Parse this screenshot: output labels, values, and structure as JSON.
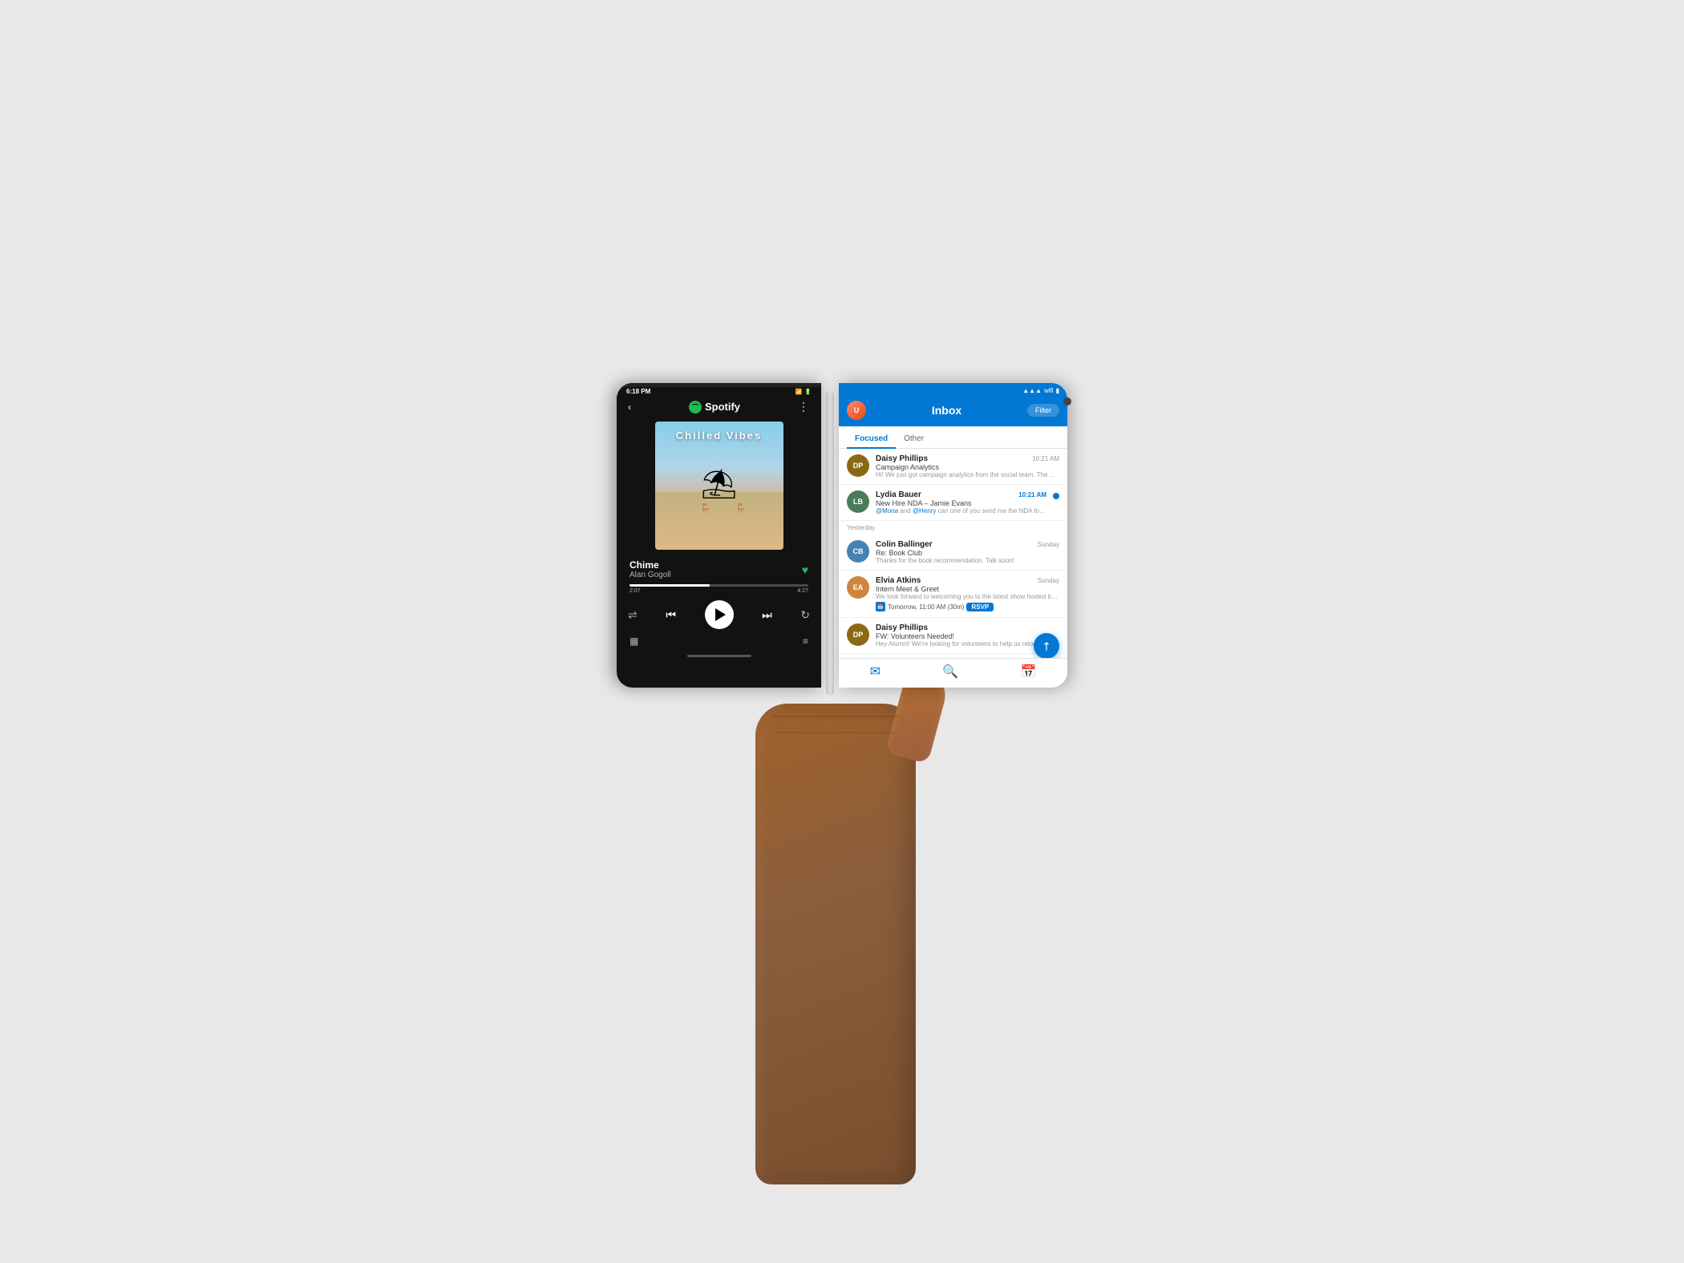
{
  "page": {
    "bg_color": "#e8e8e8"
  },
  "spotify": {
    "status_time": "6:18 PM",
    "app_name": "Spotify",
    "album_title": "Chilled Vibes",
    "song_name": "Chime",
    "artist_name": "Alan Gogoll",
    "time_elapsed": "2:07",
    "time_total": "4:27",
    "back_label": "‹",
    "more_label": "⋮"
  },
  "outlook": {
    "inbox_title": "Inbox",
    "filter_label": "Filter",
    "tab_focused": "Focused",
    "tab_other": "Other",
    "emails": [
      {
        "sender": "Daisy Phillips",
        "subject": "Campaign Analytics",
        "preview": "Hi! We just got campaign analytics from the social team. The below...",
        "time": "10:21 AM",
        "unread": false,
        "avatar_color": "#8B4513",
        "avatar_initials": "DP"
      },
      {
        "sender": "Lydia Bauer",
        "subject": "New Hire NDA – Jamie Evans",
        "preview": "@Mona and @Henry can one of you send me the NDA for Jamie...",
        "time": "10:21 AM",
        "unread": true,
        "avatar_color": "#6B8E23",
        "avatar_initials": "LB"
      },
      {
        "sender": "Colin Ballinger",
        "subject": "Re: Book Club",
        "preview": "Thanks for the book recommendation. Talk soon!",
        "time": "Sunday",
        "unread": false,
        "avatar_color": "#4682B4",
        "avatar_initials": "CB"
      },
      {
        "sender": "Elvia Atkins",
        "subject": "Intern Meet & Greet",
        "preview": "We look forward to welcoming you to the latest show hosted by none...",
        "time": "Sunday",
        "cal_info": "Tomorrow, 11:00 AM (30m)",
        "rsvp": "RSVP",
        "unread": false,
        "avatar_color": "#CD853F",
        "avatar_initials": "EA"
      },
      {
        "sender": "Daisy Phillips",
        "subject": "FW: Volunteers Needed!",
        "preview": "Hey Alumni! We're looking for volunteers to help us relocate in th...",
        "time": "",
        "unread": false,
        "avatar_color": "#8B4513",
        "avatar_initials": "DP"
      }
    ],
    "date_separator": "Yesterday",
    "nav_mail": "✉",
    "nav_search": "🔍",
    "nav_calendar": "📅",
    "compose_icon": "↗"
  }
}
